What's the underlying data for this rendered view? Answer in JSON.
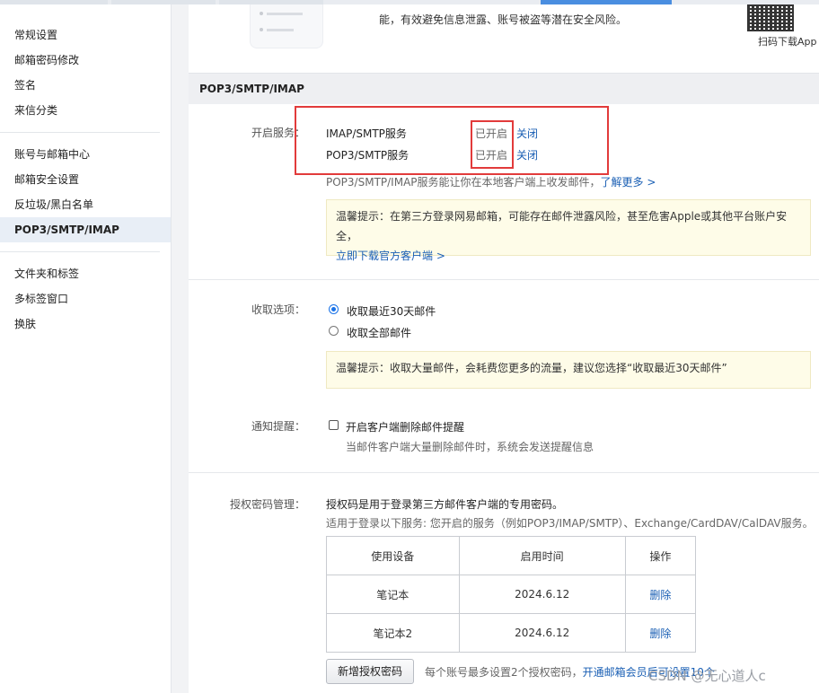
{
  "sidebar": {
    "group1": [
      "常规设置",
      "邮箱密码修改",
      "签名",
      "来信分类"
    ],
    "group2": [
      "账号与邮箱中心",
      "邮箱安全设置",
      "反垃圾/黑白名单",
      "POP3/SMTP/IMAP"
    ],
    "group3": [
      "文件夹和标签",
      "多标签窗口",
      "换肤"
    ],
    "active": "POP3/SMTP/IMAP"
  },
  "promo": {
    "text": "能，有效避免信息泄露、账号被盗等潜在安全风险。",
    "qr_label": "扫码下载App"
  },
  "section": {
    "title": "POP3/SMTP/IMAP"
  },
  "services": {
    "label": "开启服务：",
    "rows": [
      {
        "name": "IMAP/SMTP服务",
        "status": "已开启",
        "action": "关闭"
      },
      {
        "name": "POP3/SMTP服务",
        "status": "已开启",
        "action": "关闭"
      }
    ],
    "desc": "POP3/SMTP/IMAP服务能让你在本地客户端上收发邮件，",
    "learn_more": "了解更多 >",
    "tip_text": "温馨提示：在第三方登录网易邮箱，可能存在邮件泄露风险，甚至危害Apple或其他平台账户安全，",
    "tip_link": "立即下载官方客户端 >"
  },
  "receive": {
    "label": "收取选项：",
    "options": [
      "收取最近30天邮件",
      "收取全部邮件"
    ],
    "selected_index": 0,
    "tip": "温馨提示：收取大量邮件，会耗费您更多的流量，建议您选择“收取最近30天邮件”"
  },
  "notify": {
    "label": "通知提醒：",
    "checkbox_label": "开启客户端删除邮件提醒",
    "checked": false,
    "desc": "当邮件客户端大量删除邮件时，系统会发送提醒信息"
  },
  "auth": {
    "label": "授权密码管理：",
    "line1": "授权码是用于登录第三方邮件客户端的专用密码。",
    "line2": "适用于登录以下服务: 您开启的服务（例如POP3/IMAP/SMTP）、Exchange/CardDAV/CalDAV服务。",
    "table": {
      "headers": [
        "使用设备",
        "启用时间",
        "操作"
      ],
      "rows": [
        {
          "device": "笔记本",
          "date": "2024.6.12",
          "action": "删除"
        },
        {
          "device": "笔记本2",
          "date": "2024.6.12",
          "action": "删除"
        }
      ]
    },
    "add_button": "新增授权密码",
    "limit_text": "每个账号最多设置2个授权密码，",
    "upgrade_link": "开通邮箱会员后可设置10个"
  },
  "watermark": "CSDN @无心道人c",
  "colors": {
    "link": "#1a5fb4",
    "highlight": "#e23b3b",
    "tip_bg": "#fefce8"
  }
}
